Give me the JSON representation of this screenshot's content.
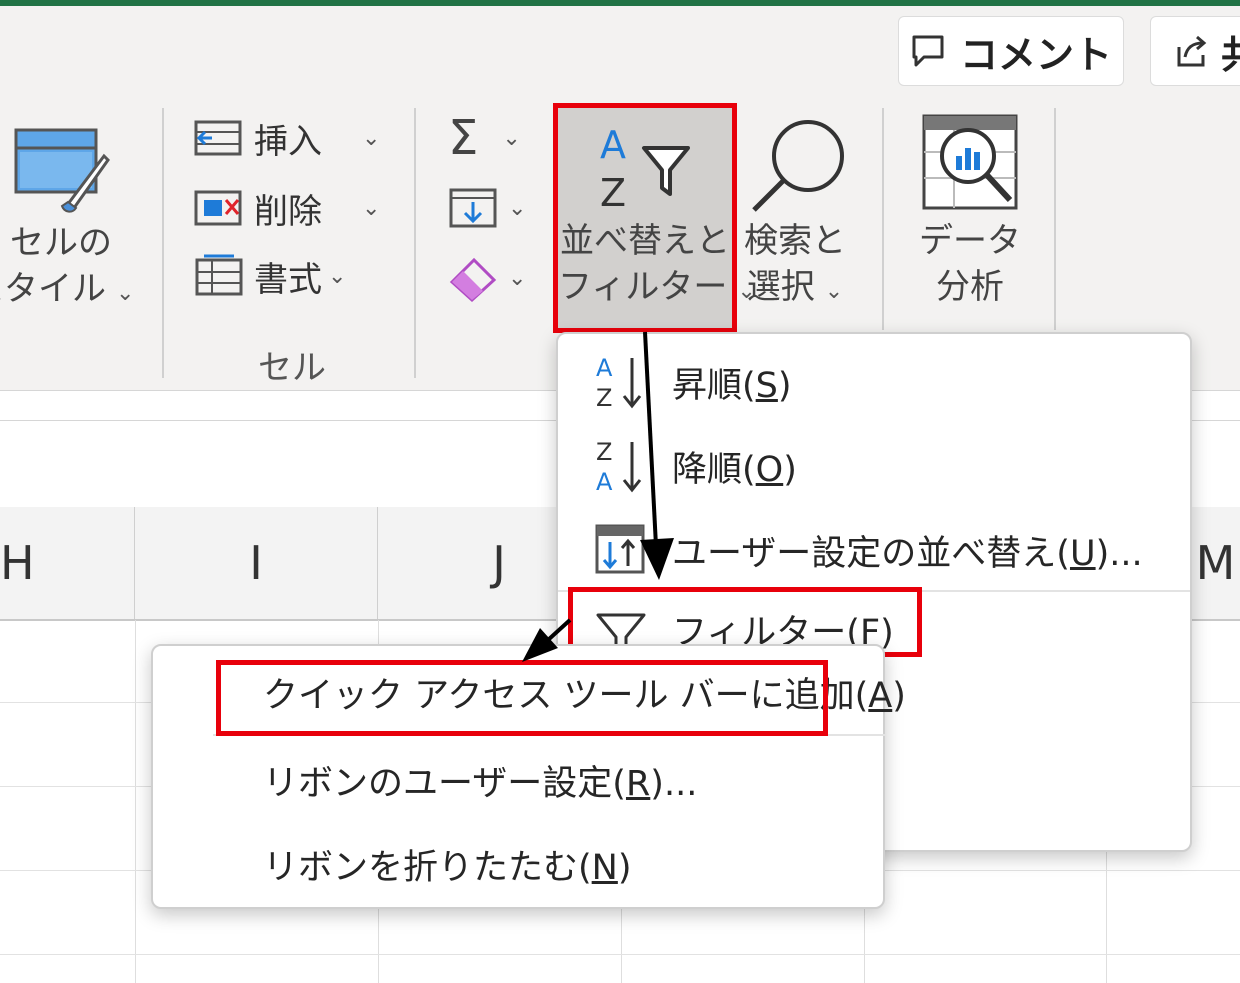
{
  "header": {
    "comment_label": "コメント",
    "share_label": "共"
  },
  "ribbon": {
    "cell_style_label_line1": "セルの",
    "cell_style_label_line2": "スタイル",
    "insert_label": "挿入",
    "delete_label": "削除",
    "format_label": "書式",
    "cells_group_label": "セル",
    "sort_filter_line1": "並べ替えと",
    "sort_filter_line2": "フィルター",
    "find_select_line1": "検索と",
    "find_select_line2": "選択",
    "data_analysis_line1": "データ",
    "data_analysis_line2": "分析"
  },
  "columns": [
    "H",
    "I",
    "J",
    "M"
  ],
  "sort_menu": {
    "items": [
      {
        "text": "昇順(",
        "key": "S",
        "suffix": ")",
        "icon": "sort-ascending-icon"
      },
      {
        "text": "降順(",
        "key": "O",
        "suffix": ")",
        "icon": "sort-descending-icon"
      },
      {
        "text": "ユーザー設定の並べ替え(",
        "key": "U",
        "suffix": ")...",
        "icon": "custom-sort-icon"
      },
      {
        "text": "フィルター(",
        "key": "F",
        "suffix": ")",
        "icon": "filter-icon"
      }
    ]
  },
  "context_menu": {
    "items": [
      {
        "text": "クイック アクセス ツール バーに追加(",
        "key": "A",
        "suffix": ")"
      },
      {
        "text": "リボンのユーザー設定(",
        "key": "R",
        "suffix": ")..."
      },
      {
        "text": "リボンを折りたたむ(",
        "key": "N",
        "suffix": ")"
      }
    ]
  },
  "colors": {
    "highlight": "#e8000b",
    "ribbon_bg": "#f3f2f1",
    "excel_green": "#217346"
  }
}
